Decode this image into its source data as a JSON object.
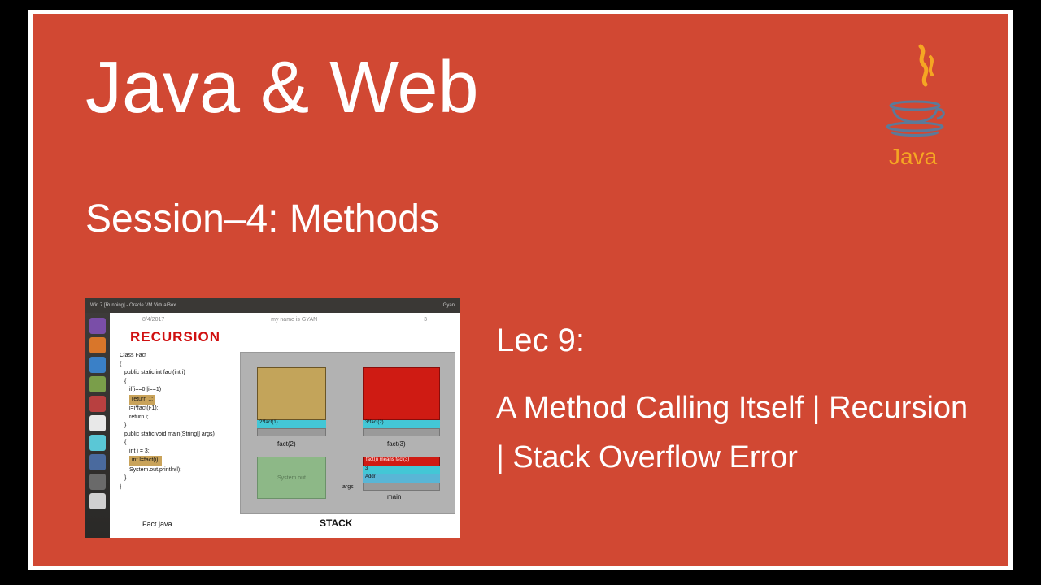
{
  "slide": {
    "mainTitle": "Java & Web",
    "subtitle": "Session–4: Methods",
    "lectureLabel": "Lec 9:",
    "lectureDescLine1": "A Method Calling Itself | Recursion",
    "lectureDescLine2": "| Stack Overflow Error",
    "javaLabel": "Java"
  },
  "thumb": {
    "titlebarLeft": "Win 7 [Running] - Oracle VM VirtualBox",
    "titlebarRight": "Gyan",
    "headerLeft": "8/4/2017",
    "headerMid": "my name is GYAN",
    "headerRight": "3",
    "recursion": "RECURSION",
    "code": {
      "l1": "Class Fact",
      "l2": "{",
      "l3": "public static int fact(int i)",
      "l4": "{",
      "l5": "if(i==0||i==1)",
      "ret": "return 1;",
      "l7": "i=i*fact(i-1);",
      "l8": "return i;",
      "l9": "}",
      "l10": "public static void main(String[] args)",
      "l11": "{",
      "l12": "int i = 3;",
      "intl": "int l=fact(i);",
      "l14": "System.out.println(l);",
      "l15": "}",
      "l16": "}"
    },
    "fname": "Fact.java",
    "stack": {
      "fact2": "fact(2)",
      "fact3": "fact(3)",
      "cyanA": "2*fact(1)",
      "cyanB": "3*fact(2)",
      "redC": "fact(i) means fact(3)",
      "cyanC": "3",
      "cyanD": "Addr",
      "args": "args",
      "main": "main",
      "green": "System.out",
      "label": "STACK"
    }
  }
}
